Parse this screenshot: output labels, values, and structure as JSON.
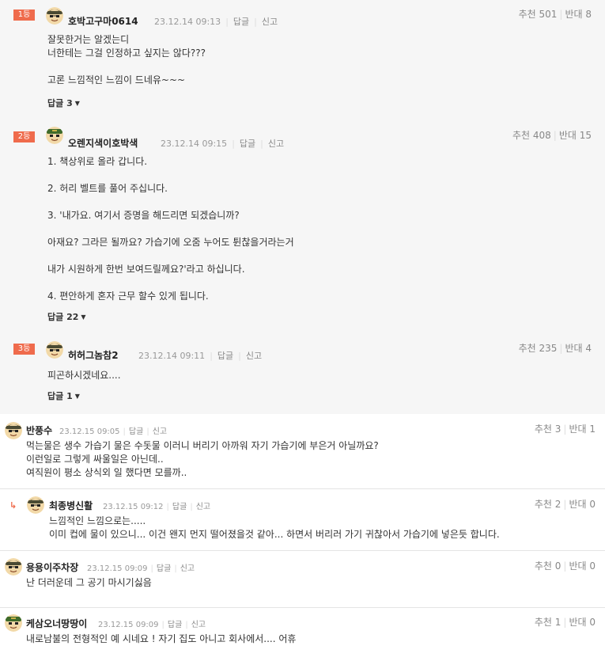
{
  "best_comments": [
    {
      "rank": "1등",
      "nick": "호박고구마0614",
      "date": "23.12.14 09:13",
      "reply_btn": "답글",
      "report_btn": "신고",
      "up": "추천 501",
      "down": "반대 8",
      "lines": [
        "잘못한거는 알겠는디",
        "너한테는 그걸 인정하고 싶지는 않다???",
        "고론 느낌적인 느낌이 드네유~~~"
      ],
      "replies": "답글 3"
    },
    {
      "rank": "2등",
      "nick": "오렌지색이호박색",
      "date": "23.12.14 09:15",
      "reply_btn": "답글",
      "report_btn": "신고",
      "up": "추천 408",
      "down": "반대 15",
      "lines": [
        "1. 책상위로 올라 갑니다.",
        "2. 허리 벨트를 풀어 주십니다.",
        "3. '내가요. 여기서 증명을 해드리면 되겠습니까?",
        "아재요? 그라믄 될까요? 가습기에 오줌 누어도 튄찮을거라는거",
        "내가 시원하게 한번 보여드릴께요?'라고 하십니다.",
        "4. 편안하게 혼자 근무 할수 있게 됩니다."
      ],
      "replies": "답글 22"
    },
    {
      "rank": "3등",
      "nick": "허허그놈참2",
      "date": "23.12.14 09:11",
      "reply_btn": "답글",
      "report_btn": "신고",
      "up": "추천 235",
      "down": "반대 4",
      "lines": [
        "피곤하시겠네요...."
      ],
      "replies": "답글 1"
    }
  ],
  "comments": [
    {
      "nick": "반풍수",
      "date": "23.12.15 09:05",
      "reply_btn": "답글",
      "report_btn": "신고",
      "up": "추천 3",
      "down": "반대 1",
      "lines": [
        "먹는물은 생수 가습기 물은 수돗물 이러니 버리기 아까워 자기 가습기에 부은거 아닐까요?",
        "이런일로 그렇게 싸울일은 아닌데..",
        "여직원이 평소 상식외 일 했다면 모를까.."
      ]
    },
    {
      "nick": "최종병신활",
      "date": "23.12.15 09:12",
      "reply_btn": "답글",
      "report_btn": "신고",
      "up": "추천 2",
      "down": "반대 0",
      "lines": [
        "느낌적인 느낌으로는.....",
        "이미 컵에 물이 있으니... 이건 왠지 먼지 떨어졌을것 같아... 하면서 버리러 가기 귀찮아서 가습기에 넣은듯 합니다."
      ]
    },
    {
      "nick": "용용이주차장",
      "date": "23.12.15 09:09",
      "reply_btn": "답글",
      "report_btn": "신고",
      "up": "추천 0",
      "down": "반대 0",
      "lines": [
        "난 더러운데 그 공기 마시기싫음"
      ]
    },
    {
      "nick": "케삼오너땅땅이",
      "date": "23.12.15 09:09",
      "reply_btn": "답글",
      "report_btn": "신고",
      "up": "추천 1",
      "down": "반대 0",
      "lines": [
        "내로남불의 전형적인 예 시네요 ! 자기 집도 아니고 회사에서.... 어휴"
      ]
    }
  ],
  "reply_arrow": "↳",
  "colors": {
    "rank_badge": "#ef6b4c",
    "best_bg": "#f6f6f6"
  }
}
